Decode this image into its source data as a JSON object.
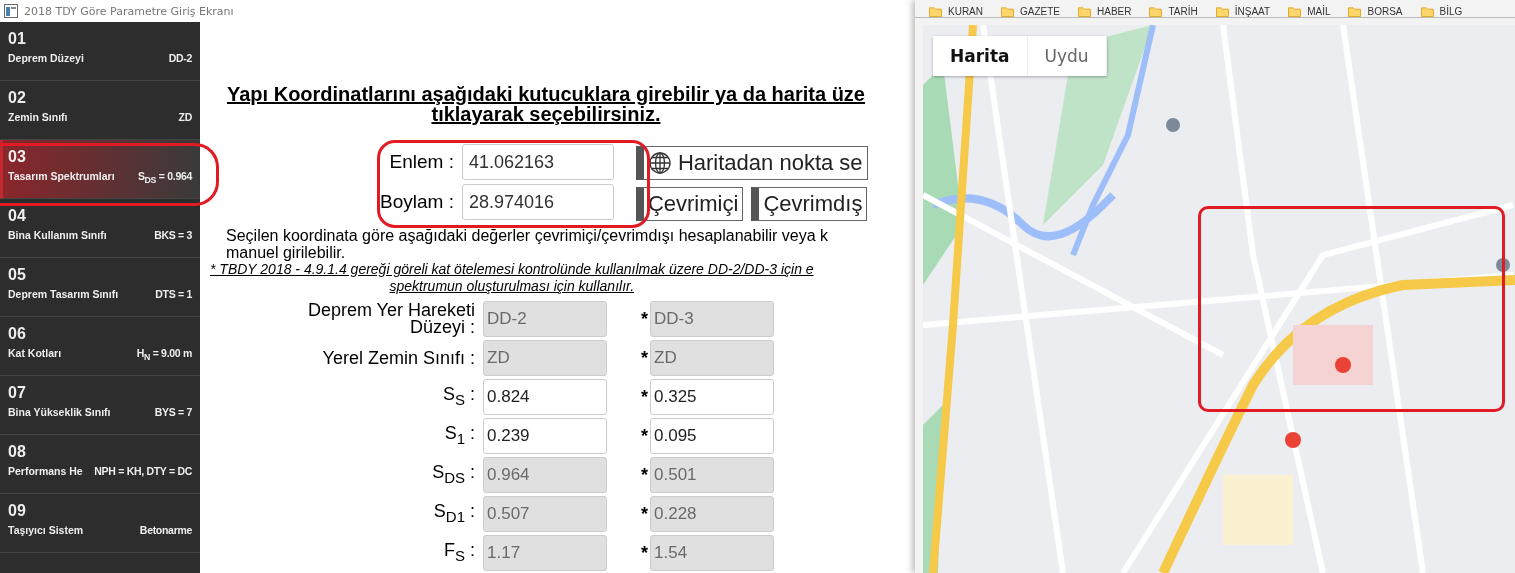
{
  "window": {
    "title": "2018 TDY Göre Parametre Giriş Ekranı"
  },
  "sidebar": {
    "items": [
      {
        "number": "01",
        "label": "Deprem Düzeyi",
        "value": "DD-2",
        "selected": false
      },
      {
        "number": "02",
        "label": "Zemin Sınıfı",
        "value": "ZD",
        "selected": false
      },
      {
        "number": "03",
        "label": "Tasarım Spektrumları",
        "value": "S$_{DS}$ = 0.964",
        "selected": true
      },
      {
        "number": "04",
        "label": "Bina Kullanım Sınıfı",
        "value": "BKS = 3",
        "selected": false
      },
      {
        "number": "05",
        "label": "Deprem Tasarım Sınıfı",
        "value": "DTS = 1",
        "selected": false
      },
      {
        "number": "06",
        "label": "Kat Kotları",
        "value": "H$_{N}$ = 9.00 m",
        "selected": false
      },
      {
        "number": "07",
        "label": "Bina Yükseklik Sınıfı",
        "value": "BYS = 7",
        "selected": false
      },
      {
        "number": "08",
        "label": "Performans He",
        "value": "NPH = KH, DTY = DC",
        "selected": false
      },
      {
        "number": "09",
        "label": "Taşıyıcı Sistem",
        "value": "Betonarme",
        "selected": false
      }
    ]
  },
  "heading": [
    "Yapı Koordinatlarını aşağıdaki kutucuklara girebilir ya da harita üze",
    "tıklayarak seçebilirsiniz."
  ],
  "coordinates": [
    {
      "label": "Enlem :",
      "value": "41.062163"
    },
    {
      "label": "Boylam :",
      "value": "28.974016"
    }
  ],
  "buttons": {
    "map_pick": "Haritadan nokta se",
    "online": "Çevrimiçi",
    "offline": "Çevrimdış"
  },
  "note": [
    "Seçilen koordinata göre aşağıdaki değerler çevrimiçi/çevrimdışı hesaplanabilir veya k",
    "manuel girilebilir."
  ],
  "footnote": [
    "* TBDY 2018 - 4.9.1.4 gereği göreli kat ötelemesi kontrolünde kullanılmak üzere DD-2/DD-3 için e",
    "spektrumun oluşturulması için kullanılır."
  ],
  "parameters": [
    {
      "label": "Deprem Yer Hareketi Düzeyi :",
      "primary": {
        "value": "DD-2",
        "disabled": true
      },
      "mark": "*",
      "secondary": {
        "value": "DD-3",
        "disabled": true
      }
    },
    {
      "label": "Yerel Zemin Sınıfı :",
      "primary": {
        "value": "ZD",
        "disabled": true
      },
      "mark": "*",
      "secondary": {
        "value": "ZD",
        "disabled": true
      }
    },
    {
      "label": "S$_{S}$ :",
      "primary": {
        "value": "0.824",
        "disabled": false
      },
      "mark": "*",
      "secondary": {
        "value": "0.325",
        "disabled": false
      }
    },
    {
      "label": "S$_{1}$ :",
      "primary": {
        "value": "0.239",
        "disabled": false
      },
      "mark": "*",
      "secondary": {
        "value": "0.095",
        "disabled": false
      }
    },
    {
      "label": "S$_{DS}$ :",
      "primary": {
        "value": "0.964",
        "disabled": true
      },
      "mark": "*",
      "secondary": {
        "value": "0.501",
        "disabled": true
      }
    },
    {
      "label": "S$_{D1}$ :",
      "primary": {
        "value": "0.507",
        "disabled": true
      },
      "mark": "*",
      "secondary": {
        "value": "0.228",
        "disabled": true
      }
    },
    {
      "label": "F$_{S}$ :",
      "primary": {
        "value": "1.17",
        "disabled": true
      },
      "mark": "*",
      "secondary": {
        "value": "1.54",
        "disabled": true
      }
    }
  ],
  "browser": {
    "bookmarks": [
      "KURAN",
      "GAZETE",
      "HABER",
      "TARİH",
      "İNŞAAT",
      "MAİL",
      "BORSA",
      "BİLG"
    ],
    "map_types": [
      {
        "label": "Harita",
        "selected": true
      },
      {
        "label": "Uydu",
        "selected": false
      }
    ]
  }
}
